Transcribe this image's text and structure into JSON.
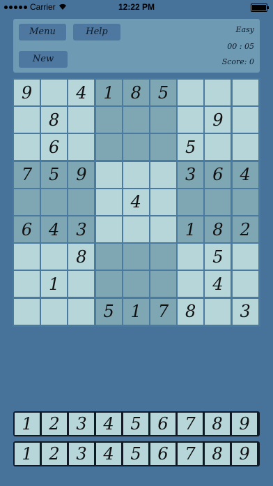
{
  "status_bar": {
    "carrier": "Carrier",
    "time": "12:22 PM",
    "wifi_icon": "wifi-icon",
    "battery_icon": "battery-icon"
  },
  "toolbar": {
    "menu_label": "Menu",
    "help_label": "Help",
    "new_label": "New",
    "difficulty": "Easy",
    "timer": "00 : 05",
    "score": "Score: 0"
  },
  "board": {
    "rows": [
      [
        "9",
        "",
        "4",
        "1",
        "8",
        "5",
        "",
        "",
        ""
      ],
      [
        "",
        "8",
        "",
        "",
        "",
        "",
        "",
        "9",
        ""
      ],
      [
        "",
        "6",
        "",
        "",
        "",
        "",
        "5",
        "",
        ""
      ],
      [
        "7",
        "5",
        "9",
        "",
        "",
        "",
        "3",
        "6",
        "4"
      ],
      [
        "",
        "",
        "",
        "",
        "4",
        "",
        "",
        "",
        ""
      ],
      [
        "6",
        "4",
        "3",
        "",
        "",
        "",
        "1",
        "8",
        "2"
      ],
      [
        "",
        "",
        "8",
        "",
        "",
        "",
        "",
        "5",
        ""
      ],
      [
        "",
        "1",
        "",
        "",
        "",
        "",
        "",
        "4",
        ""
      ],
      [
        "",
        "",
        "",
        "5",
        "1",
        "7",
        "8",
        "",
        "3"
      ]
    ]
  },
  "number_pads": [
    [
      "1",
      "2",
      "3",
      "4",
      "5",
      "6",
      "7",
      "8",
      "9"
    ],
    [
      "1",
      "2",
      "3",
      "4",
      "5",
      "6",
      "7",
      "8",
      "9"
    ]
  ],
  "colors": {
    "background": "#47729a",
    "panel": "#6e9ab3",
    "button": "#4f78a0",
    "cell_light": "#b7d6da",
    "cell_dark": "#7ea7b3"
  }
}
